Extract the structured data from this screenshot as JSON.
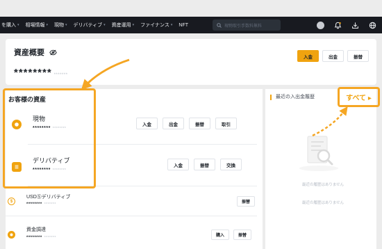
{
  "nav": {
    "items": [
      {
        "label": "を購入",
        "caret": true
      },
      {
        "label": "相場情報",
        "caret": true
      },
      {
        "label": "現物",
        "caret": true
      },
      {
        "label": "デリバティブ",
        "caret": true
      },
      {
        "label": "資産運用",
        "caret": true
      },
      {
        "label": "ファイナンス",
        "caret": true
      },
      {
        "label": "NFT",
        "caret": false
      }
    ],
    "search_placeholder": "現物取引手数料無料"
  },
  "overview": {
    "title": "資産概要",
    "balance": "********",
    "balance_sub": "*******",
    "actions": [
      "入金",
      "出金",
      "振替"
    ]
  },
  "assets": {
    "title": "お客様の資産",
    "rows": [
      {
        "name": "現物",
        "balance": "********",
        "balance_sub": "********",
        "actions": [
          "入金",
          "出金",
          "振替",
          "取引"
        ]
      },
      {
        "name": "デリバティブ",
        "balance": "********",
        "balance_sub": "********",
        "actions": [
          "入金",
          "振替",
          "交換"
        ]
      },
      {
        "name": "USDⓈデリバティブ",
        "balance": "********",
        "balance_sub": "*******",
        "actions": [
          "振替"
        ]
      },
      {
        "name": "資金調達",
        "balance": "********",
        "balance_sub": "*******",
        "actions": [
          "購入",
          "振替"
        ]
      }
    ]
  },
  "records": {
    "title": "最近の入出金履歴",
    "see_all": "すべて ▸",
    "empty_deposit": "最近の履歴はありません",
    "empty_withdraw": "最近の履歴はありません"
  },
  "colors": {
    "accent": "#f0a30f",
    "highlight": "#f5a623",
    "nav_bg": "#181a20"
  }
}
